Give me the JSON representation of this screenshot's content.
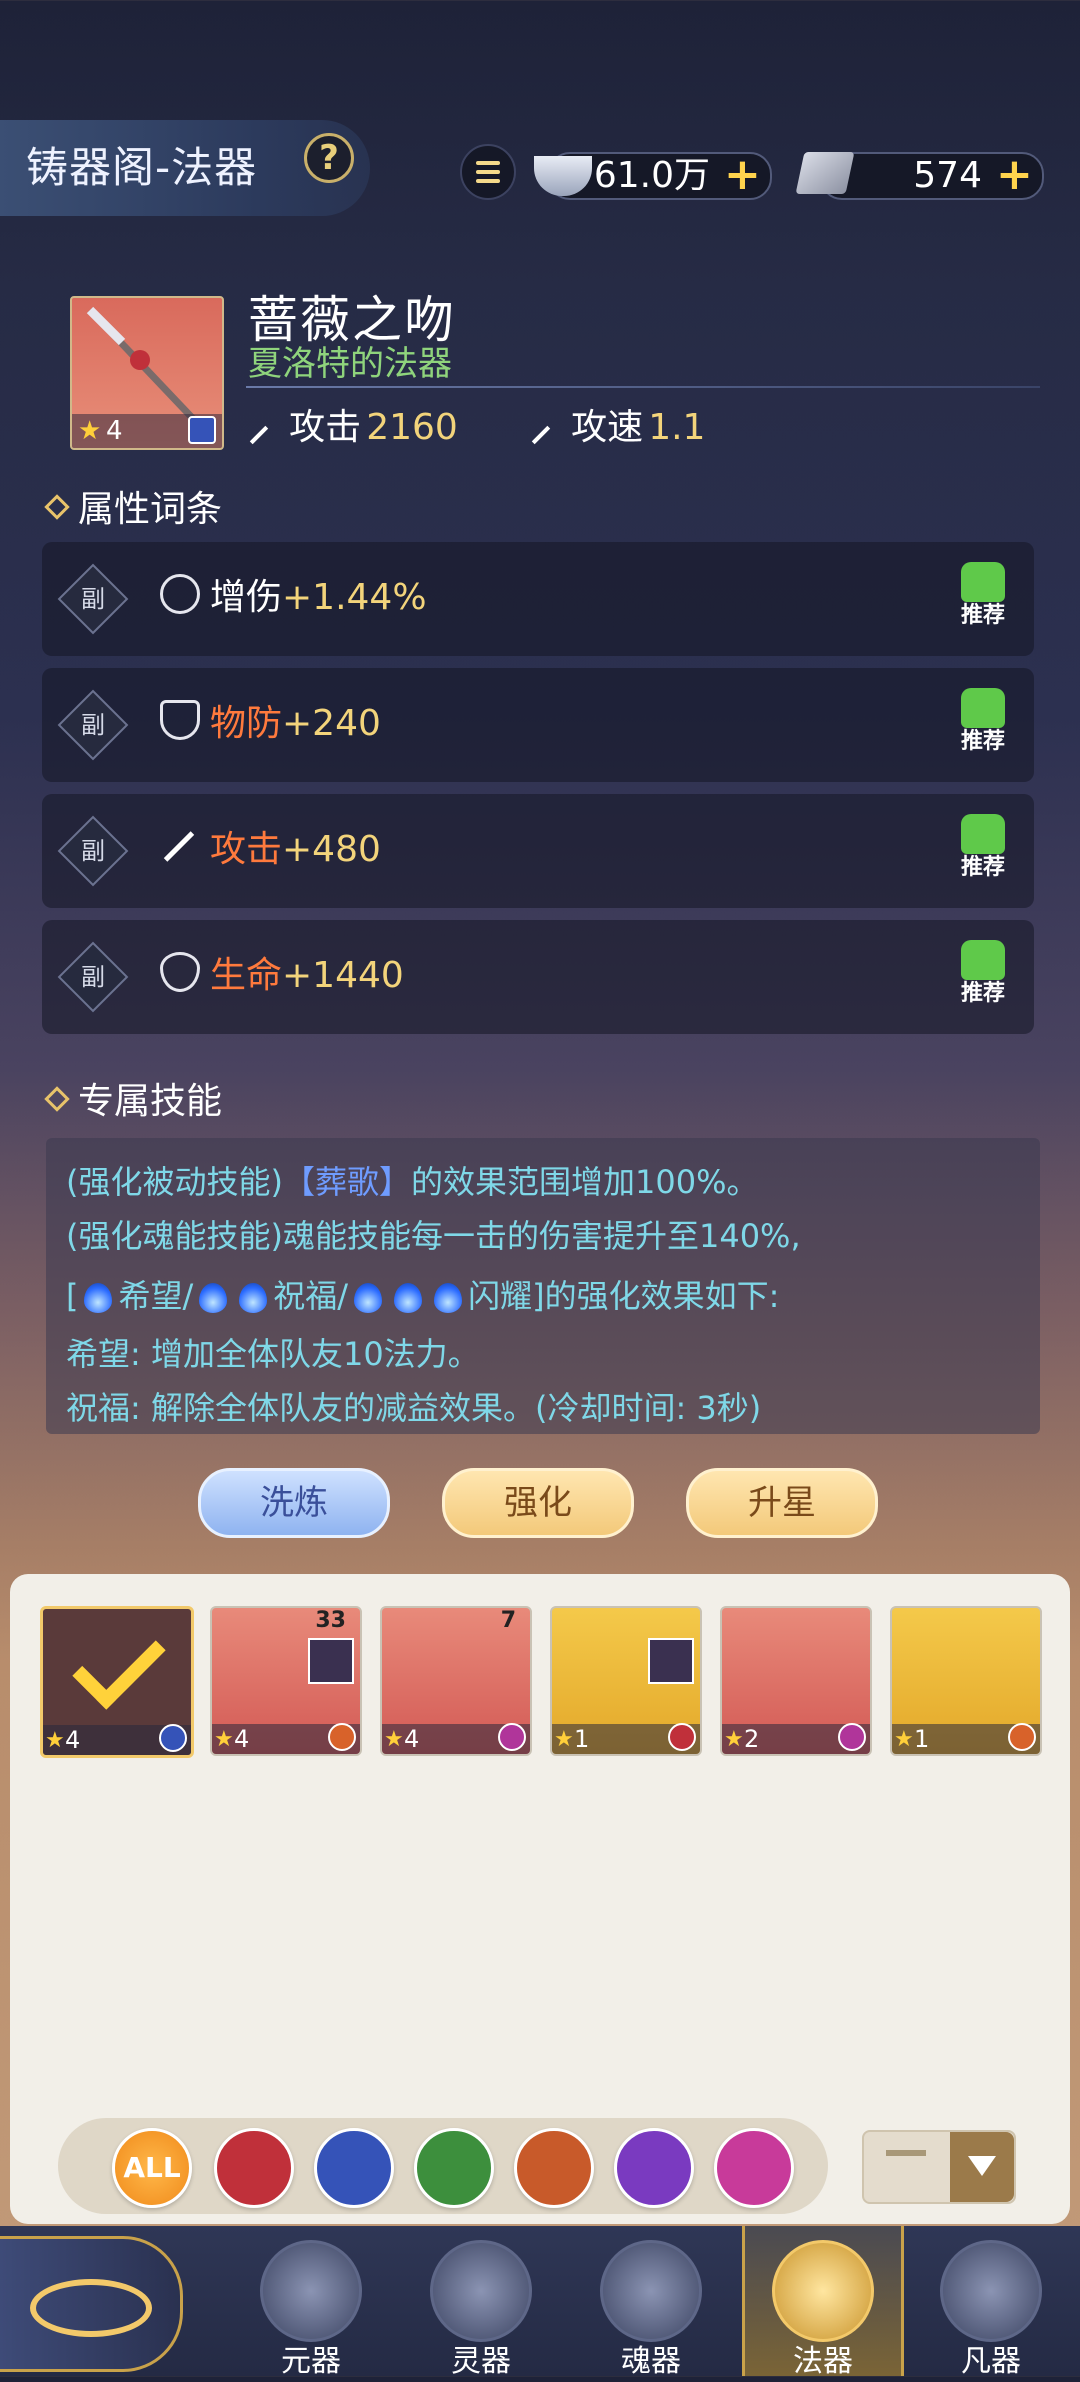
{
  "header": {
    "title": "铸器阁-法器",
    "help_icon": "?",
    "currency_silver": "61.0万",
    "currency_ore": "574"
  },
  "weapon": {
    "name": "蔷薇之吻",
    "subtitle": "夏洛特的法器",
    "star": "4",
    "attack_label": "攻击",
    "attack_value": "2160",
    "speed_label": "攻速",
    "speed_value": "1.1"
  },
  "attributes": {
    "title": "属性词条",
    "tag": "副",
    "recommend": "推荐",
    "items": [
      {
        "name": "增伤",
        "value": "+1.44%"
      },
      {
        "name": "物防",
        "value": "+240"
      },
      {
        "name": "攻击",
        "value": "+480"
      },
      {
        "name": "生命",
        "value": "+1440"
      }
    ]
  },
  "skill": {
    "title": "专属技能",
    "line1_a": "(强化被动技能)",
    "line1_b": "【葬歌】",
    "line1_c": "的效果范围增加100%。",
    "line2": "(强化魂能技能)魂能技能每一击的伤害提升至140%,",
    "line3_a": "[",
    "line3_b": "希望/",
    "line3_c": "祝福/",
    "line3_d": "闪耀]的强化效果如下:",
    "line4": "希望: 增加全体队友10法力。",
    "line5": "祝福: 解除全体队友的减益效果。(冷却时间: 3秒)"
  },
  "actions": {
    "refine": "洗炼",
    "enhance": "强化",
    "star_up": "升星"
  },
  "inventory": [
    {
      "level": "4",
      "count": ""
    },
    {
      "level": "4",
      "count": "33"
    },
    {
      "level": "4",
      "count": "7"
    },
    {
      "level": "1",
      "count": ""
    },
    {
      "level": "2",
      "count": ""
    },
    {
      "level": "1",
      "count": ""
    }
  ],
  "filter": {
    "all": "ALL"
  },
  "nav": {
    "items": [
      "元器",
      "灵器",
      "魂器",
      "法器",
      "凡器"
    ],
    "active": "法器"
  }
}
